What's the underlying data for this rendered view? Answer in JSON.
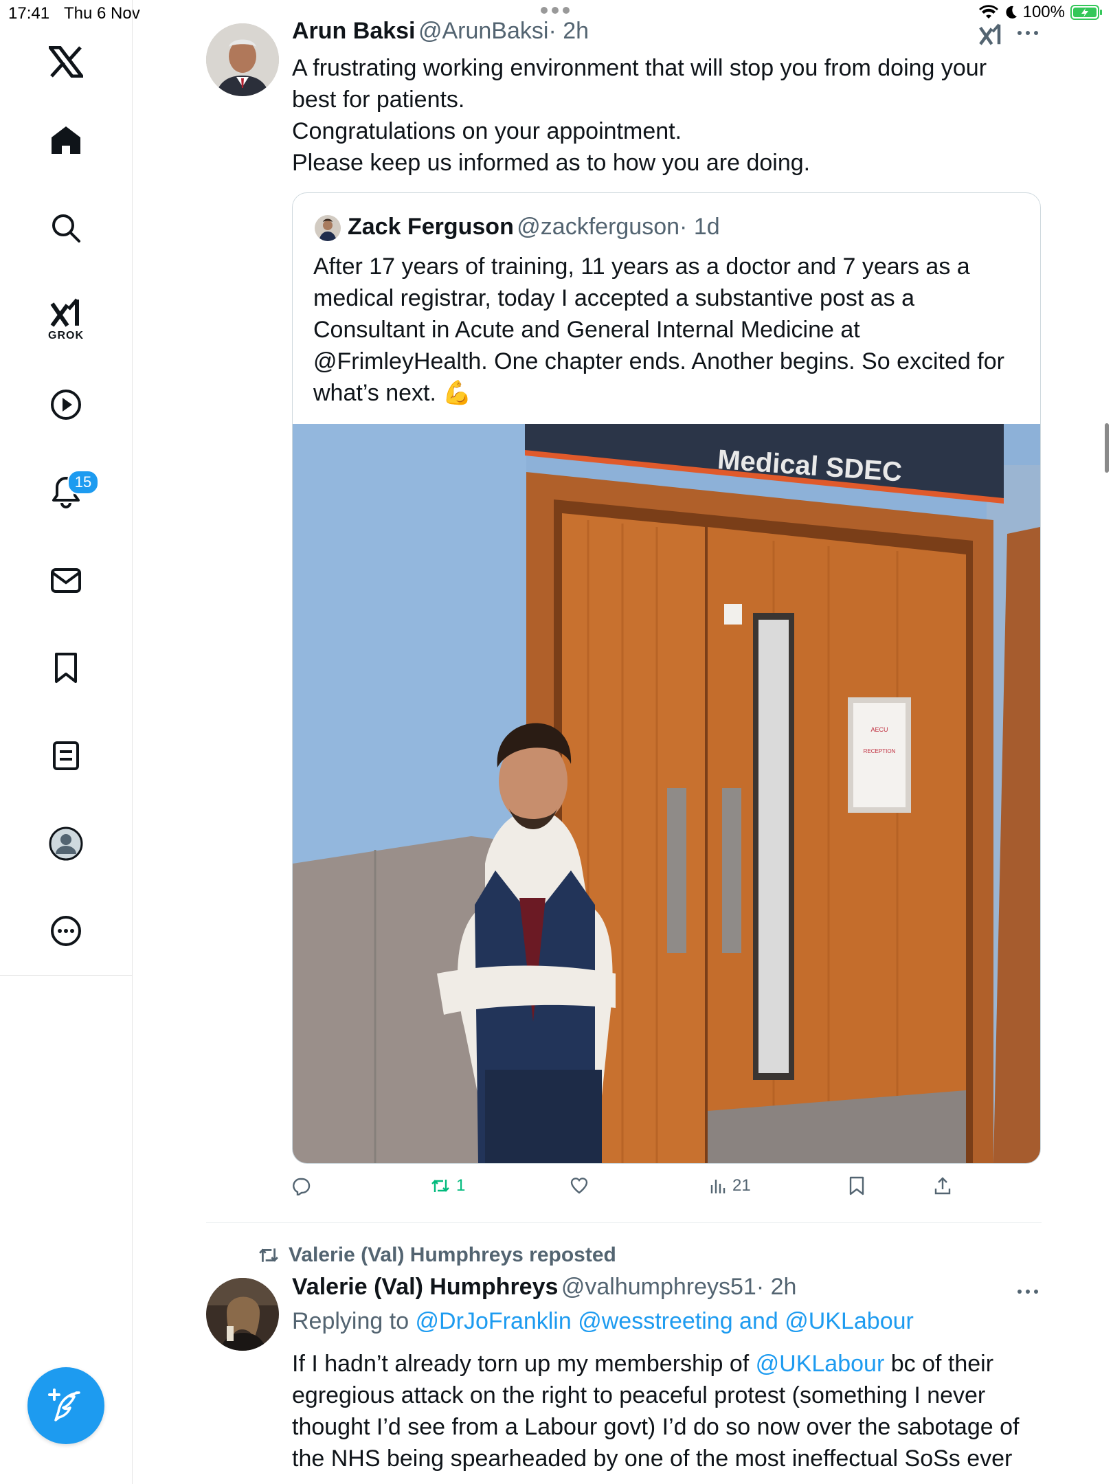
{
  "status_bar": {
    "time": "17:41",
    "date": "Thu 6 Nov",
    "battery": "100%"
  },
  "sidebar": {
    "items": [
      {
        "icon": "x-logo-icon"
      },
      {
        "icon": "home-icon"
      },
      {
        "icon": "search-icon"
      },
      {
        "icon": "grok-icon",
        "label": "GROK"
      },
      {
        "icon": "video-icon"
      },
      {
        "icon": "notifications-icon",
        "badge": "15"
      },
      {
        "icon": "messages-icon"
      },
      {
        "icon": "bookmarks-icon"
      },
      {
        "icon": "lists-icon"
      },
      {
        "icon": "profile-icon"
      },
      {
        "icon": "more-icon"
      }
    ],
    "compose_icon": "compose-icon"
  },
  "post1": {
    "name": "Arun Baksi",
    "handle": "@ArunBaksi",
    "time": "· 2h",
    "lines": [
      "A frustrating working environment that will stop you from doing your",
      "best for patients.",
      "Congratulations on your appointment.",
      "Please keep us informed as to how you are doing."
    ],
    "quote": {
      "name": "Zack Ferguson",
      "handle": "@zackferguson",
      "time": "· 1d",
      "lines": [
        "After 17 years of training, 11 years as a doctor and 7 years as a",
        "medical registrar, today I accepted a substantive post as a",
        "Consultant in Acute and General Internal Medicine at",
        "@FrimleyHealth. One chapter ends. Another begins. So excited for",
        "what’s next. 💪"
      ],
      "photo": {
        "sign": "Medical SDEC",
        "notice_line1": "AECU",
        "notice_line2": "RECEPTION"
      }
    },
    "actions": {
      "reposts": "1",
      "views": "21"
    }
  },
  "post2": {
    "repost_label": "Valerie (Val) Humphreys reposted",
    "name": "Valerie (Val) Humphreys",
    "handle": "@valhumphreys51",
    "time": "· 2h",
    "replying_prefix": "Replying to ",
    "replying_to": "@DrJoFranklin @wesstreeting and @UKLabour",
    "line1_a": "If I hadn’t already torn up my membership of ",
    "line1_link": "@UKLabour",
    "line1_b": " bc of  their",
    "lines": [
      "egregious attack on the right to peaceful protest (something I never",
      "thought I’d see from a Labour govt) I’d do so now over the sabotage of",
      "the NHS being spearheaded by one of the most ineffectual SoSs ever"
    ]
  },
  "colors": {
    "accent": "#1d9bf0",
    "repost_green": "#00ba7c",
    "secondary_text": "#536471"
  }
}
